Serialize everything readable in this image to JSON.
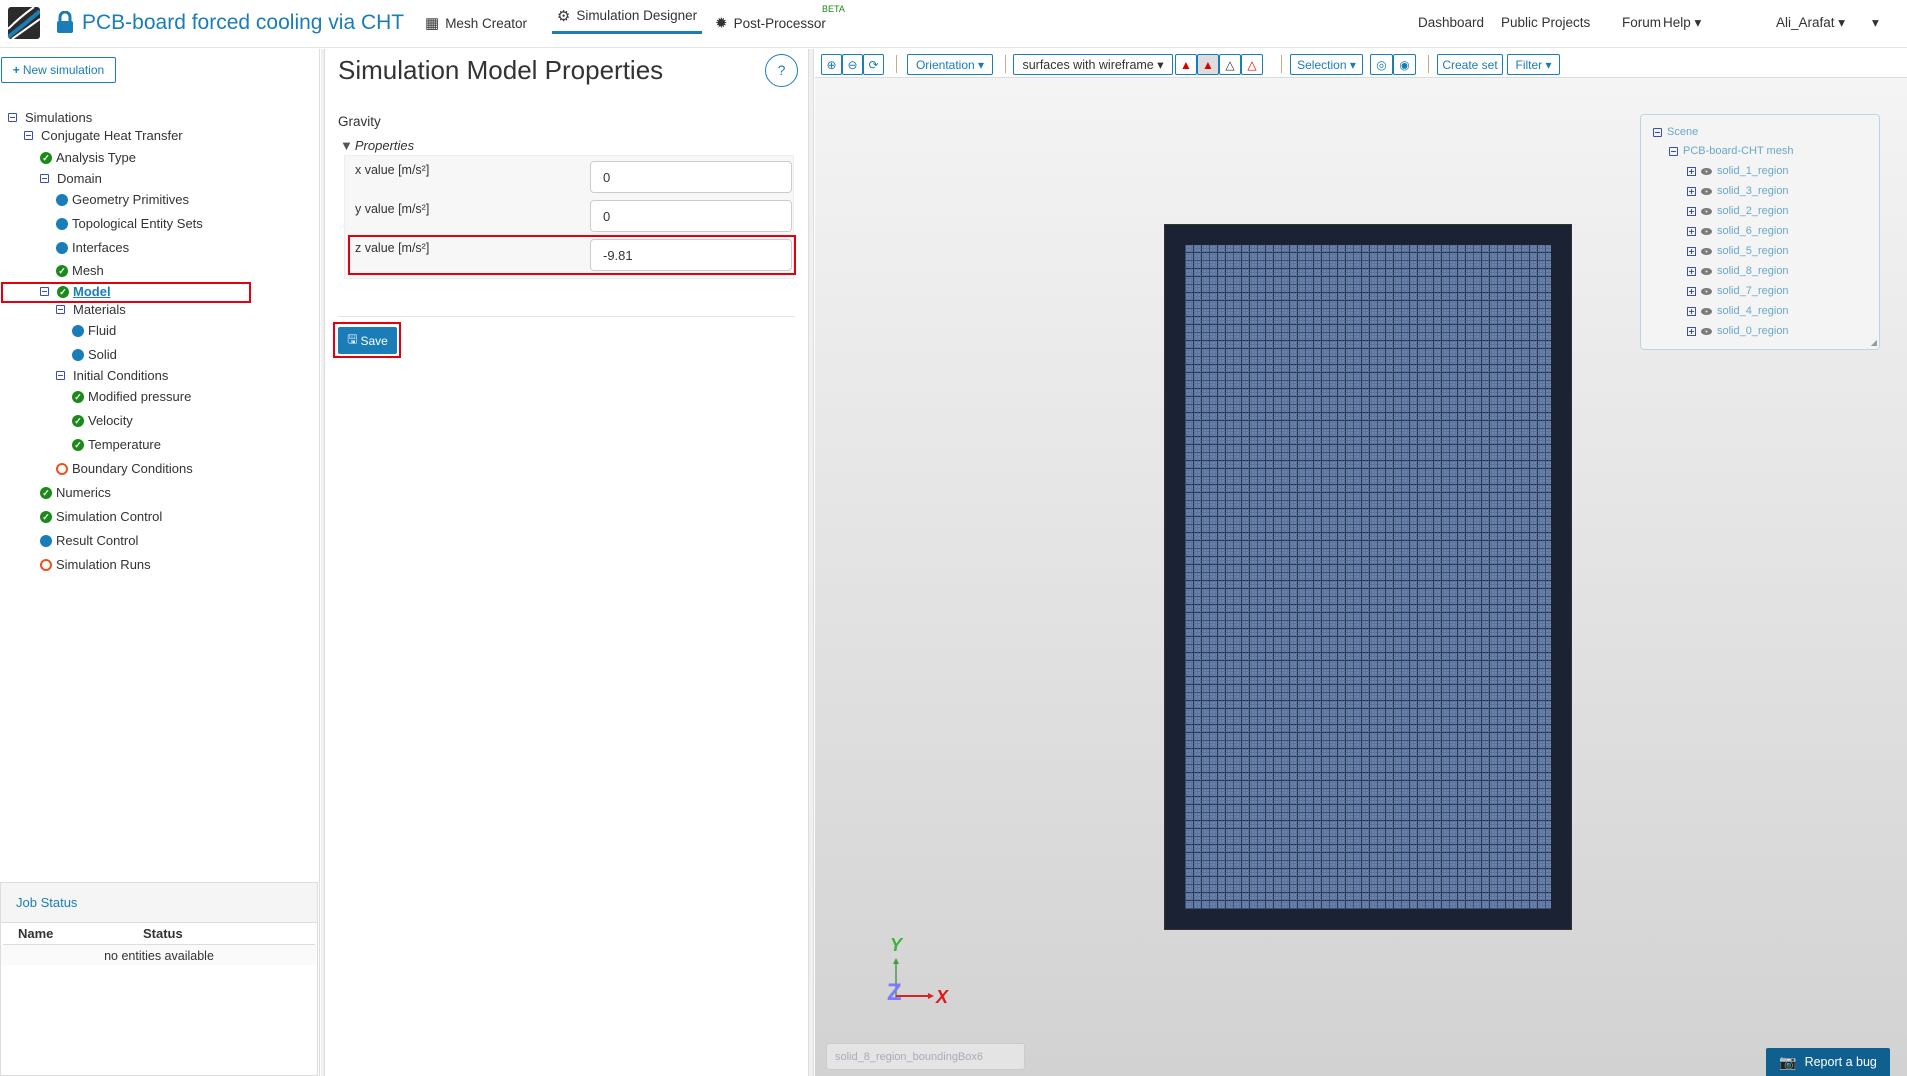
{
  "header": {
    "title": "PCB-board forced cooling via CHT",
    "nav": [
      {
        "label": "Mesh Creator",
        "icon": "grid-icon"
      },
      {
        "label": "Simulation Designer",
        "icon": "gears-icon",
        "active": true
      },
      {
        "label": "Post-Processor",
        "icon": "cog-icon",
        "badge": "BETA"
      }
    ],
    "right": [
      "Dashboard",
      "Public Projects",
      "Forum",
      "Help"
    ],
    "user": "Ali_Arafat"
  },
  "left": {
    "new_simulation": "New simulation",
    "tree": [
      {
        "label": "Simulations",
        "level": 0,
        "icon": "minus"
      },
      {
        "label": "Conjugate Heat Transfer",
        "level": 1,
        "icon": "minus"
      },
      {
        "label": "Analysis Type",
        "level": 2,
        "icon": "ok"
      },
      {
        "label": "Domain",
        "level": 2,
        "icon": "minus"
      },
      {
        "label": "Geometry Primitives",
        "level": 3,
        "icon": "dot"
      },
      {
        "label": "Topological Entity Sets",
        "level": 3,
        "icon": "dot"
      },
      {
        "label": "Interfaces",
        "level": 3,
        "icon": "dot"
      },
      {
        "label": "Mesh",
        "level": 3,
        "icon": "ok"
      },
      {
        "label": "Model",
        "level": 2,
        "icon": "minus-ok",
        "selected": true
      },
      {
        "label": "Materials",
        "level": 3,
        "icon": "minus"
      },
      {
        "label": "Fluid",
        "level": 4,
        "icon": "dot"
      },
      {
        "label": "Solid",
        "level": 4,
        "icon": "dot"
      },
      {
        "label": "Initial Conditions",
        "level": 3,
        "icon": "minus"
      },
      {
        "label": "Modified pressure",
        "level": 4,
        "icon": "ok"
      },
      {
        "label": "Velocity",
        "level": 4,
        "icon": "ok"
      },
      {
        "label": "Temperature",
        "level": 4,
        "icon": "ok"
      },
      {
        "label": "Boundary Conditions",
        "level": 3,
        "icon": "ring"
      },
      {
        "label": "Numerics",
        "level": 2,
        "icon": "ok"
      },
      {
        "label": "Simulation Control",
        "level": 2,
        "icon": "ok"
      },
      {
        "label": "Result Control",
        "level": 2,
        "icon": "dot"
      },
      {
        "label": "Simulation Runs",
        "level": 2,
        "icon": "ring"
      }
    ],
    "job_status": {
      "title": "Job Status",
      "columns": [
        "Name",
        "Status"
      ],
      "empty": "no entities available"
    }
  },
  "mid": {
    "title": "Simulation Model Properties",
    "help": "?",
    "section": "Gravity",
    "group": "Properties",
    "fields": [
      {
        "label": "x value [m/s²]",
        "value": "0"
      },
      {
        "label": "y value [m/s²]",
        "value": "0"
      },
      {
        "label": "z value [m/s²]",
        "value": "-9.81"
      }
    ],
    "save": "Save"
  },
  "viewer": {
    "orientation": "Orientation",
    "render_mode": "surfaces with wireframe",
    "selection": "Selection",
    "create_set": "Create set",
    "filter": "Filter",
    "scene": {
      "root": "Scene",
      "mesh": "PCB-board-CHT mesh",
      "regions": [
        "solid_1_region",
        "solid_3_region",
        "solid_2_region",
        "solid_6_region",
        "solid_5_region",
        "solid_8_region",
        "solid_7_region",
        "solid_4_region",
        "solid_0_region"
      ]
    },
    "axes": {
      "y": "Y",
      "z": "Z",
      "x": "X"
    },
    "selection_box": "solid_8_region_boundingBox6",
    "report_bug": "Report a bug"
  },
  "colors": {
    "accent": "#1a7db8",
    "highlight": "#e0000f",
    "ok": "#1a8a1a",
    "pending": "#e8531c"
  }
}
